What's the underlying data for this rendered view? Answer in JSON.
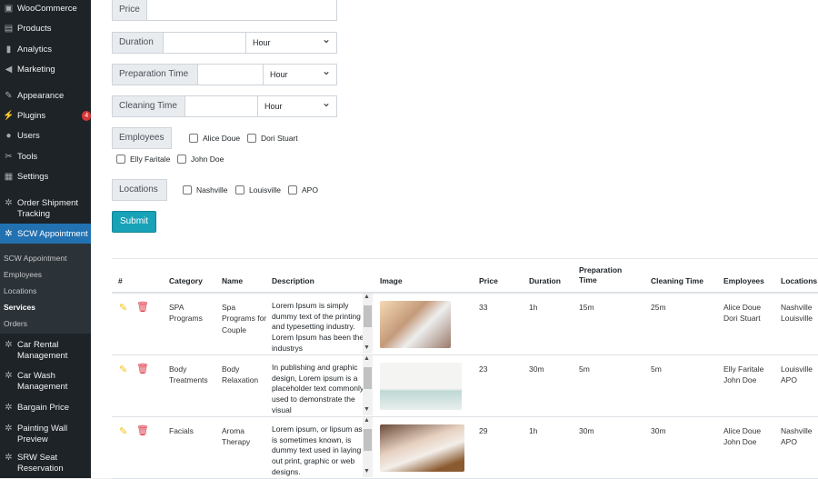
{
  "sidebar": {
    "items": [
      {
        "label": "WooCommerce",
        "icon": "woo-icon"
      },
      {
        "label": "Products",
        "icon": "archive-icon"
      },
      {
        "label": "Analytics",
        "icon": "chart-icon"
      },
      {
        "label": "Marketing",
        "icon": "megaphone-icon"
      },
      {
        "label": "Appearance",
        "icon": "brush-icon"
      },
      {
        "label": "Plugins",
        "icon": "plugin-icon",
        "badge": "4"
      },
      {
        "label": "Users",
        "icon": "user-icon"
      },
      {
        "label": "Tools",
        "icon": "wrench-icon"
      },
      {
        "label": "Settings",
        "icon": "settings-icon"
      },
      {
        "label": "Order Shipment Tracking",
        "icon": "gear-icon"
      },
      {
        "label": "SCW Appointment",
        "icon": "gear-icon"
      },
      {
        "label": "Car Rental Management",
        "icon": "gear-icon"
      },
      {
        "label": "Car Wash Management",
        "icon": "gear-icon"
      },
      {
        "label": "Bargain Price",
        "icon": "gear-icon"
      },
      {
        "label": "Painting Wall Preview",
        "icon": "gear-icon"
      },
      {
        "label": "SRW Seat Reservation",
        "icon": "gear-icon"
      }
    ],
    "submenu": [
      "SCW Appointment",
      "Employees",
      "Locations",
      "Services",
      "Orders"
    ]
  },
  "form": {
    "price": "Price",
    "duration": "Duration",
    "prep": "Preparation Time",
    "cleaning": "Cleaning Time",
    "unit": "Hour",
    "employees_label": "Employees",
    "employees": [
      "Alice Doue",
      "Dori Stuart",
      "Elly Faritale",
      "John Doe"
    ],
    "locations_label": "Locations",
    "locations": [
      "Nashville",
      "Louisville",
      "APO"
    ],
    "submit": "Submit"
  },
  "table": {
    "headers": [
      "#",
      "Category",
      "Name",
      "Description",
      "Image",
      "Price",
      "Duration",
      "Preparation Time",
      "Cleaning Time",
      "Employees",
      "Locations"
    ],
    "rows": [
      {
        "category": "SPA Programs",
        "name": "Spa Programs for Couple",
        "description": "Lorem Ipsum is simply dummy text of the printing and typesetting industry. Lorem Ipsum has been the industrys",
        "price": "33",
        "duration": "1h",
        "prep": "15m",
        "cleaning": "25m",
        "employees": "Alice Doue\nDori Stuart",
        "locations": "Nashville\nLouisville"
      },
      {
        "category": "Body Treatments",
        "name": "Body Relaxation",
        "description": "In publishing and graphic design, Lorem ipsum is a placeholder text commonly used to demonstrate the visual",
        "price": "23",
        "duration": "30m",
        "prep": "5m",
        "cleaning": "5m",
        "employees": "Elly Faritale\nJohn Doe",
        "locations": "Louisville\nAPO"
      },
      {
        "category": "Facials",
        "name": "Aroma Therapy",
        "description": "Lorem ipsum, or lipsum as it is sometimes known, is dummy text used in laying out print, graphic or web designs.",
        "price": "29",
        "duration": "1h",
        "prep": "30m",
        "cleaning": "30m",
        "employees": "Alice Doue\nJohn Doe",
        "locations": "Nashville\nAPO"
      }
    ]
  }
}
